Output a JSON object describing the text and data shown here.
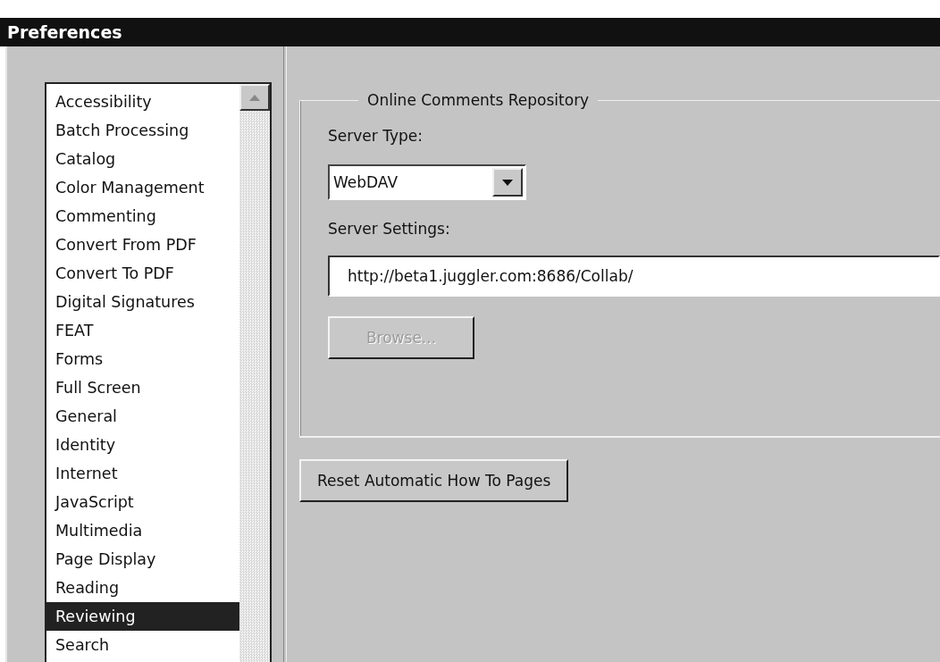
{
  "window": {
    "title": "Preferences"
  },
  "categories": [
    {
      "label": "Accessibility",
      "selected": false
    },
    {
      "label": "Batch Processing",
      "selected": false
    },
    {
      "label": "Catalog",
      "selected": false
    },
    {
      "label": "Color Management",
      "selected": false
    },
    {
      "label": "Commenting",
      "selected": false
    },
    {
      "label": "Convert From PDF",
      "selected": false
    },
    {
      "label": "Convert To PDF",
      "selected": false
    },
    {
      "label": "Digital Signatures",
      "selected": false
    },
    {
      "label": "FEAT",
      "selected": false
    },
    {
      "label": "Forms",
      "selected": false
    },
    {
      "label": "Full Screen",
      "selected": false
    },
    {
      "label": "General",
      "selected": false
    },
    {
      "label": "Identity",
      "selected": false
    },
    {
      "label": "Internet",
      "selected": false
    },
    {
      "label": "JavaScript",
      "selected": false
    },
    {
      "label": "Multimedia",
      "selected": false
    },
    {
      "label": "Page Display",
      "selected": false
    },
    {
      "label": "Reading",
      "selected": false
    },
    {
      "label": "Reviewing",
      "selected": true
    },
    {
      "label": "Search",
      "selected": false
    }
  ],
  "group": {
    "title": "Online Comments Repository",
    "server_type": {
      "label": "Server Type:",
      "value": "WebDAV"
    },
    "server_settings": {
      "label": "Server Settings:",
      "value": "http://beta1.juggler.com:8686/Collab/"
    },
    "browse_button": {
      "label": "Browse...",
      "disabled": true
    }
  },
  "reset_button": {
    "label": "Reset Automatic How To Pages",
    "disabled": false
  }
}
